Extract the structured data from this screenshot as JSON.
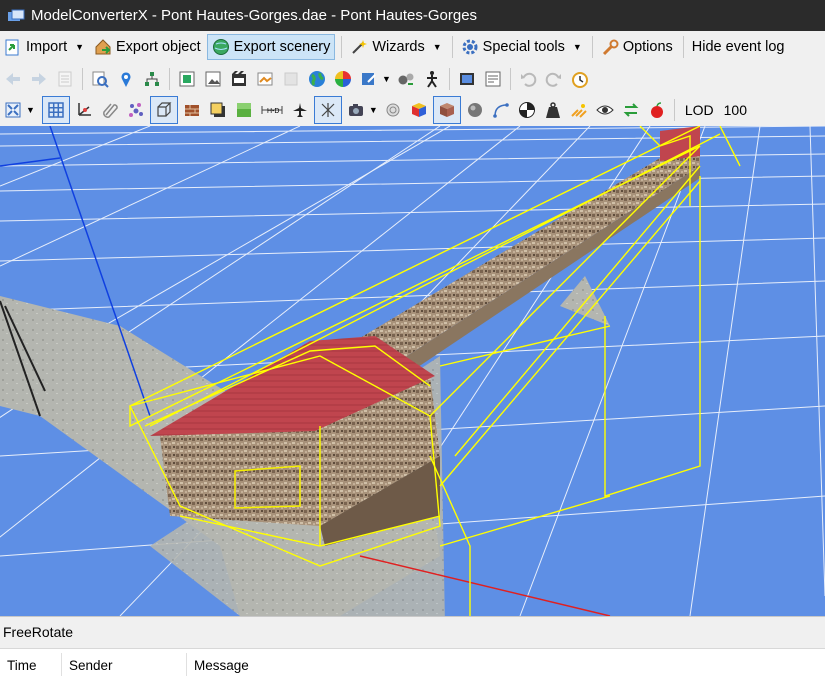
{
  "window": {
    "title": "ModelConverterX - Pont Hautes-Gorges.dae - Pont Hautes-Gorges"
  },
  "menu": {
    "import_label": "Import",
    "export_object_label": "Export object",
    "export_scenery_label": "Export scenery",
    "wizards_label": "Wizards",
    "special_tools_label": "Special tools",
    "options_label": "Options",
    "hide_event_log_label": "Hide event log"
  },
  "toolbar2": {
    "lod_label": "LOD",
    "lod_value": "100"
  },
  "status": {
    "mode": "FreeRotate"
  },
  "event_log": {
    "columns": [
      "Time",
      "Sender",
      "Message"
    ]
  },
  "colors": {
    "viewport_bg": "#5e8fe5",
    "roof": "#b8404a",
    "bbox": "#ffff00",
    "grid": "#ffffff",
    "selected_bg": "#cce4f7"
  }
}
